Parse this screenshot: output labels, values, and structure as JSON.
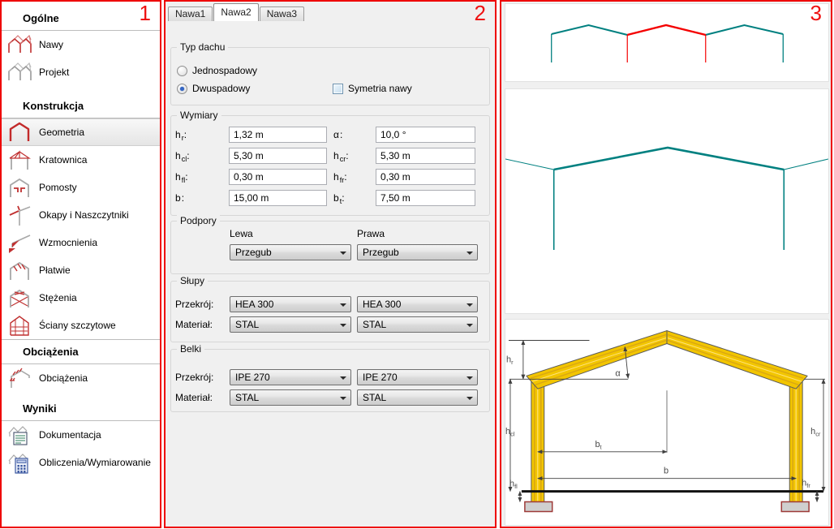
{
  "panels": {
    "left_num": "1",
    "center_num": "2",
    "right_num": "3"
  },
  "sidebar": {
    "sections": [
      {
        "header": "Ogólne",
        "items": [
          {
            "label": "Nawy",
            "icon": "nawy-icon",
            "selected": false
          },
          {
            "label": "Projekt",
            "icon": "projekt-icon",
            "selected": false
          }
        ]
      },
      {
        "header": "Konstrukcja",
        "items": [
          {
            "label": "Geometria",
            "icon": "geometria-icon",
            "selected": true
          },
          {
            "label": "Kratownica",
            "icon": "kratownica-icon",
            "selected": false
          },
          {
            "label": "Pomosty",
            "icon": "pomosty-icon",
            "selected": false
          },
          {
            "label": "Okapy i Naszczytniki",
            "icon": "okapy-icon",
            "selected": false
          },
          {
            "label": "Wzmocnienia",
            "icon": "wzmocnienia-icon",
            "selected": false
          },
          {
            "label": "Płatwie",
            "icon": "platwie-icon",
            "selected": false
          },
          {
            "label": "Stężenia",
            "icon": "stezenia-icon",
            "selected": false
          },
          {
            "label": "Ściany szczytowe",
            "icon": "sciany-icon",
            "selected": false
          }
        ]
      },
      {
        "header": "Obciążenia",
        "items": [
          {
            "label": "Obciążenia",
            "icon": "obciazenia-icon",
            "selected": false
          }
        ]
      },
      {
        "header": "Wyniki",
        "items": [
          {
            "label": "Dokumentacja",
            "icon": "dokumentacja-icon",
            "selected": false
          },
          {
            "label": "Obliczenia/Wymiarowanie",
            "icon": "obliczenia-icon",
            "selected": false
          }
        ]
      }
    ]
  },
  "tabs": [
    {
      "label": "Nawa1",
      "active": false
    },
    {
      "label": "Nawa2",
      "active": true
    },
    {
      "label": "Nawa3",
      "active": false
    }
  ],
  "form": {
    "colon": ":",
    "typ_dachu": {
      "title": "Typ dachu",
      "radio_jednospadowy": "Jednospadowy",
      "radio_dwuspadowy": "Dwuspadowy",
      "selected_option": "Dwuspadowy",
      "checkbox_label": "Symetria nawy",
      "checkbox_checked": false
    },
    "wymiary": {
      "title": "Wymiary",
      "rows": [
        {
          "l_base": "h",
          "l_sub": "r",
          "l_val": "1,32 m",
          "r_base": "α",
          "r_sub": "",
          "r_val": "10,0 °"
        },
        {
          "l_base": "h",
          "l_sub": "cl",
          "l_val": "5,30 m",
          "r_base": "h",
          "r_sub": "cr",
          "r_val": "5,30 m"
        },
        {
          "l_base": "h",
          "l_sub": "fl",
          "l_val": "0,30 m",
          "r_base": "h",
          "r_sub": "fr",
          "r_val": "0,30 m"
        },
        {
          "l_base": "b",
          "l_sub": "",
          "l_val": "15,00 m",
          "r_base": "b",
          "r_sub": "t",
          "r_val": "7,50 m"
        }
      ]
    },
    "podpory": {
      "title": "Podpory",
      "col_left": "Lewa",
      "col_right": "Prawa",
      "left_value": "Przegub",
      "right_value": "Przegub"
    },
    "slupy": {
      "title": "Słupy",
      "przekroj_label": "Przekrój:",
      "material_label": "Materiał:",
      "przekroj": [
        "HEA 300",
        "HEA 300"
      ],
      "material": [
        "STAL",
        "STAL"
      ]
    },
    "belki": {
      "title": "Belki",
      "przekroj_label": "Przekrój:",
      "material_label": "Materiał:",
      "przekroj": [
        "IPE 270",
        "IPE 270"
      ],
      "material": [
        "STAL",
        "STAL"
      ]
    }
  },
  "preview": {
    "bays_total": "3",
    "highlighted_bay": "2"
  },
  "diagram": {
    "hr_base": "h",
    "hr_sub": "r",
    "alpha": "α",
    "hcl_base": "h",
    "hcl_sub": "cl",
    "hcr_base": "h",
    "hcr_sub": "cr",
    "bt_base": "b",
    "bt_sub": "t",
    "b_label": "b",
    "hfl_base": "h",
    "hfl_sub": "fl",
    "hfr_base": "h",
    "hfr_sub": "fr"
  },
  "colors": {
    "accent_red": "#ee0000",
    "drawing_teal": "#008080",
    "drawing_red": "#f40000",
    "frame_yellow": "#f2c500",
    "footing_border": "#9e3a38"
  }
}
